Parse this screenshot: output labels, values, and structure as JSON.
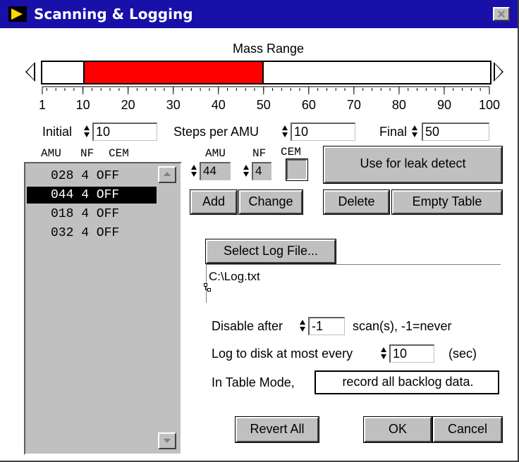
{
  "window": {
    "title": "Scanning & Logging"
  },
  "mass_range": {
    "label": "Mass Range",
    "min": 1,
    "max": 100,
    "low": 10,
    "high": 50,
    "fill_color": "#ff0000",
    "ticks": [
      "1",
      "10",
      "20",
      "30",
      "40",
      "50",
      "60",
      "70",
      "80",
      "90",
      "100"
    ]
  },
  "params": {
    "initial_label": "Initial",
    "initial_value": "10",
    "steps_label": "Steps per AMU",
    "steps_value": "10",
    "final_label": "Final",
    "final_value": "50"
  },
  "table": {
    "headers": {
      "amu": "AMU",
      "nf": "NF",
      "cem": "CEM"
    },
    "rows": [
      "028 4 OFF",
      "044 4 OFF",
      "018 4 OFF",
      "032 4 OFF"
    ],
    "selected_index": 1
  },
  "entry": {
    "amu_label": "AMU",
    "nf_label": "NF",
    "cem_label": "CEM",
    "amu_value": "44",
    "nf_value": "4"
  },
  "buttons": {
    "leak": "Use for leak detect",
    "add": "Add",
    "change": "Change",
    "delete": "Delete",
    "empty": "Empty Table",
    "select_log": "Select Log File...",
    "record": "record all backlog data.",
    "revert": "Revert All",
    "ok": "OK",
    "cancel": "Cancel"
  },
  "log": {
    "path": "C:\\Log.txt",
    "disable_label": "Disable after",
    "disable_value": "-1",
    "disable_suffix": "scan(s), -1=never",
    "every_label": "Log to disk at most every",
    "every_value": "10",
    "every_suffix": "(sec)",
    "table_mode_label": "In Table Mode,"
  }
}
